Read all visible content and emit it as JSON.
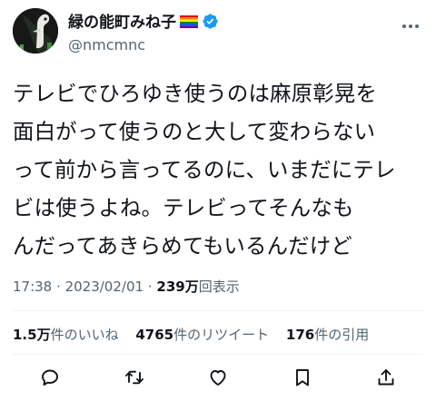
{
  "author": {
    "display_name": "緑の能町みね子",
    "handle": "@nmcmnc",
    "rainbow_flag_icon": "rainbow-flag-icon",
    "verified_icon": "verified-badge-icon"
  },
  "tweet": {
    "lines": [
      "テレビでひろゆき使うのは麻原彰晃を",
      "面白がって使うのと大して変わらない",
      "って前から言ってるのに、いまだにテレ",
      "ビは使うよね。テレビってそんなも",
      "んだってあきらめてもいるんだけど"
    ]
  },
  "meta": {
    "time": "17:38",
    "sep1": "·",
    "date": "2023/02/01",
    "sep2": "·",
    "views_count": "239万",
    "views_label": "回表示"
  },
  "stats": {
    "likes_count": "1.5万",
    "likes_label": "件のいいね",
    "retweets_count": "4765",
    "retweets_label": "件のリツイート",
    "quotes_count": "176",
    "quotes_label": "件の引用"
  },
  "actions": [
    "reply-icon",
    "retweet-icon",
    "like-icon",
    "bookmark-icon",
    "share-icon"
  ],
  "colors": {
    "text": "#0f1419",
    "secondary": "#536471",
    "divider": "#eff3f4",
    "verified": "#1d9bf0"
  }
}
